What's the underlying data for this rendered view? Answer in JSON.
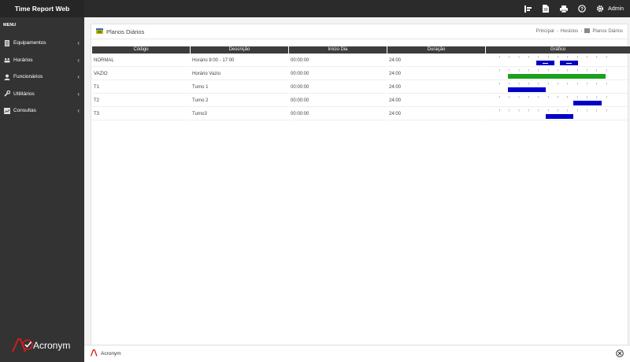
{
  "app": {
    "title": "Time Report Web"
  },
  "topbar": {
    "user": "Admin"
  },
  "sidebar": {
    "menu_title": "MENU",
    "items": [
      {
        "label": "Equipamentos",
        "icon": "server-icon"
      },
      {
        "label": "Horários",
        "icon": "team-icon"
      },
      {
        "label": "Funcionários",
        "icon": "users-icon"
      },
      {
        "label": "Utilitários",
        "icon": "wrench-icon"
      },
      {
        "label": "Consultas",
        "icon": "chart-icon"
      }
    ],
    "logo": "Acronym"
  },
  "page": {
    "title": "Planos Diários",
    "breadcrumb": [
      "Principal",
      "Horários",
      "Planos Diários"
    ]
  },
  "table": {
    "headers": [
      "Código",
      "Descrição",
      "Início Dia",
      "Duração",
      "Gráfico"
    ],
    "rows": [
      {
        "codigo": "NORMAL",
        "descricao": "Horário 8:00 - 17:00",
        "inicio": "00:00:00",
        "duracao": "24:00",
        "bars": [
          {
            "start": 0.35,
            "end": 0.52,
            "color": "#0000c8",
            "marker": true
          },
          {
            "start": 0.57,
            "end": 0.74,
            "color": "#0000c8",
            "marker": true
          }
        ]
      },
      {
        "codigo": "VAZIO",
        "descricao": "Horário Vazio",
        "inicio": "00:00:00",
        "duracao": "24:00",
        "bars": [
          {
            "start": 0.09,
            "end": 1.0,
            "color": "#1aa11a",
            "marker": false
          }
        ]
      },
      {
        "codigo": "T1",
        "descricao": "Turno 1",
        "inicio": "00:00:00",
        "duracao": "24:00",
        "bars": [
          {
            "start": 0.09,
            "end": 0.44,
            "color": "#0000c8",
            "marker": false
          }
        ]
      },
      {
        "codigo": "T2",
        "descricao": "Turno 2",
        "inicio": "00:00:00",
        "duracao": "24:00",
        "bars": [
          {
            "start": 0.7,
            "end": 0.96,
            "color": "#0000c8",
            "marker": false
          }
        ]
      },
      {
        "codigo": "T3",
        "descricao": "Turno3",
        "inicio": "00:00:00",
        "duracao": "24:00",
        "bars": [
          {
            "start": 0.44,
            "end": 0.7,
            "color": "#0000c8",
            "marker": false
          }
        ]
      }
    ]
  },
  "footer": {
    "brand": "Acronym"
  }
}
